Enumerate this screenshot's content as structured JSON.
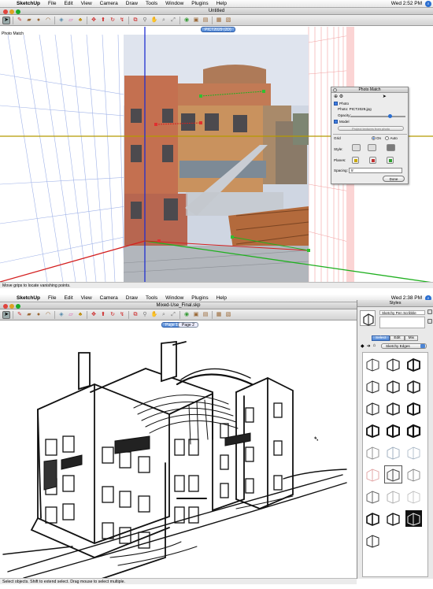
{
  "screen_top": {
    "menubar": {
      "apple": "",
      "app": "SketchUp",
      "items": [
        "File",
        "Edit",
        "View",
        "Camera",
        "Draw",
        "Tools",
        "Window",
        "Plugins",
        "Help"
      ],
      "clock": "Wed 2:52 PM"
    },
    "window_title": "Untitled",
    "scene_tab": "PICT2029 (2D)",
    "viewport_label": "Photo Match",
    "status": "Move grips to locate vanishing points.",
    "photo_match": {
      "title": "Photo Match",
      "photo_label": "Photo",
      "photo_name_label": "Photo:",
      "photo_name": "PICT2029.jpg",
      "opacity_label": "Opacity:",
      "opacity_value": 0.72,
      "model_label": "Model",
      "project_button": "Project textures from photo",
      "grid_label": "Grid",
      "grid_on": "On",
      "grid_auto": "Auto",
      "style_label": "Style:",
      "planes_label": "Planes:",
      "spacing_label": "Spacing:",
      "spacing_value": "5'",
      "done": "Done"
    }
  },
  "screen_bottom": {
    "menubar": {
      "apple": "",
      "app": "SketchUp",
      "items": [
        "File",
        "Edit",
        "View",
        "Camera",
        "Draw",
        "Tools",
        "Window",
        "Plugins",
        "Help"
      ],
      "clock": "Wed 2:38 PM"
    },
    "window_title": "Mixed-Use_Final.skp",
    "scene_tabs": [
      "Page 1",
      "Page 2"
    ],
    "status": "Select objects. Shift to extend select. Drag mouse to select multiple.",
    "styles_panel": {
      "title": "Styles",
      "style_name": "Sketchy Pen Scribble",
      "tabs": [
        "Select",
        "Edit",
        "Mix"
      ],
      "collection": "Sketchy Edges"
    }
  },
  "colors": {
    "axis_red": "#d42020",
    "axis_green": "#20b020",
    "axis_blue": "#2030d0",
    "horizon": "#b49a00",
    "accent_blue": "#4d86d6"
  },
  "icons": {
    "toolbar": [
      "select",
      "eraser",
      "pencil",
      "rectangle",
      "circle",
      "arc",
      "make-component",
      "paint-bucket",
      "push-pull",
      "move",
      "rotate",
      "follow-me",
      "offset",
      "tape",
      "text",
      "orbit",
      "pan",
      "zoom",
      "zoom-window",
      "zoom-extents",
      "previous",
      "next",
      "get-models",
      "share-model",
      "component-browser",
      "photo-textures",
      "add-location",
      "preview-earth"
    ]
  }
}
